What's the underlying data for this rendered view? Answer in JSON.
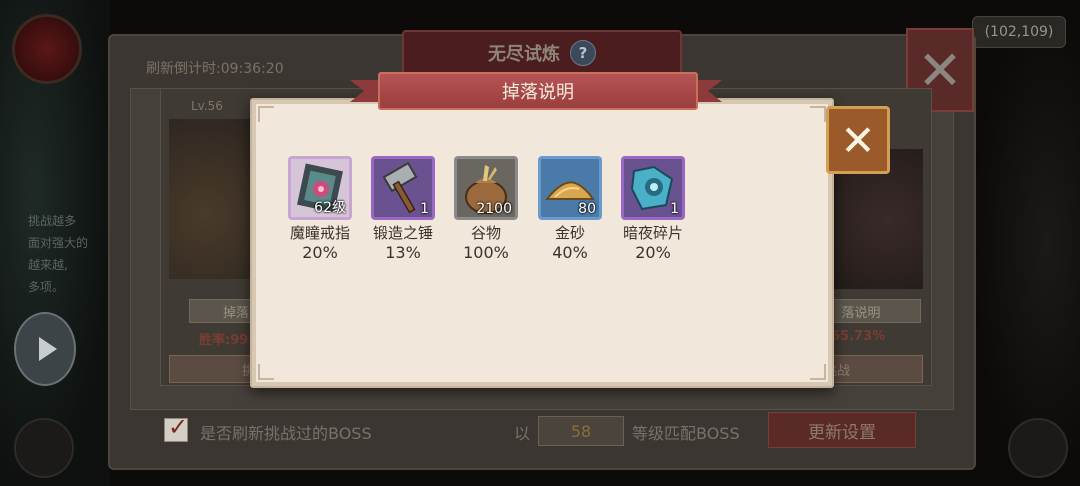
{
  "background": {
    "coords": "(102,109)",
    "left_text": "挑战越多\n面对强大的\n越来越,\n多项。",
    "main_panel": {
      "title": "无尽试炼",
      "help_label": "?",
      "refresh_countdown_label": "刷新倒计时:",
      "refresh_countdown_value": "09:36:20",
      "close_label": "✕",
      "cards": [
        {
          "level": "Lv.56",
          "drop_button": "掉落说明",
          "win_rate": "胜率:99.",
          "fight_button": "挑战"
        },
        {
          "level": "",
          "drop_button": "落说明",
          "win_rate": "65.73%",
          "fight_button": "挑战"
        }
      ],
      "refresh_checkbox_label": "是否刷新挑战过的BOSS",
      "match_prefix": "以",
      "match_level": "58",
      "match_suffix": "等级匹配BOSS",
      "update_button": "更新设置"
    }
  },
  "popup": {
    "title": "掉落说明",
    "close_label": "✕",
    "items": [
      {
        "name": "魔瞳戒指",
        "qty": "62级",
        "chance": "20%",
        "rarity": "pink",
        "icon": "ring-icon"
      },
      {
        "name": "锻造之锤",
        "qty": "1",
        "chance": "13%",
        "rarity": "purple",
        "icon": "hammer-icon"
      },
      {
        "name": "谷物",
        "qty": "2100",
        "chance": "100%",
        "rarity": "gray",
        "icon": "grain-sack-icon"
      },
      {
        "name": "金砂",
        "qty": "80",
        "chance": "40%",
        "rarity": "blue",
        "icon": "gold-sand-icon"
      },
      {
        "name": "暗夜碎片",
        "qty": "1",
        "chance": "20%",
        "rarity": "purple",
        "icon": "night-shard-icon"
      }
    ]
  }
}
